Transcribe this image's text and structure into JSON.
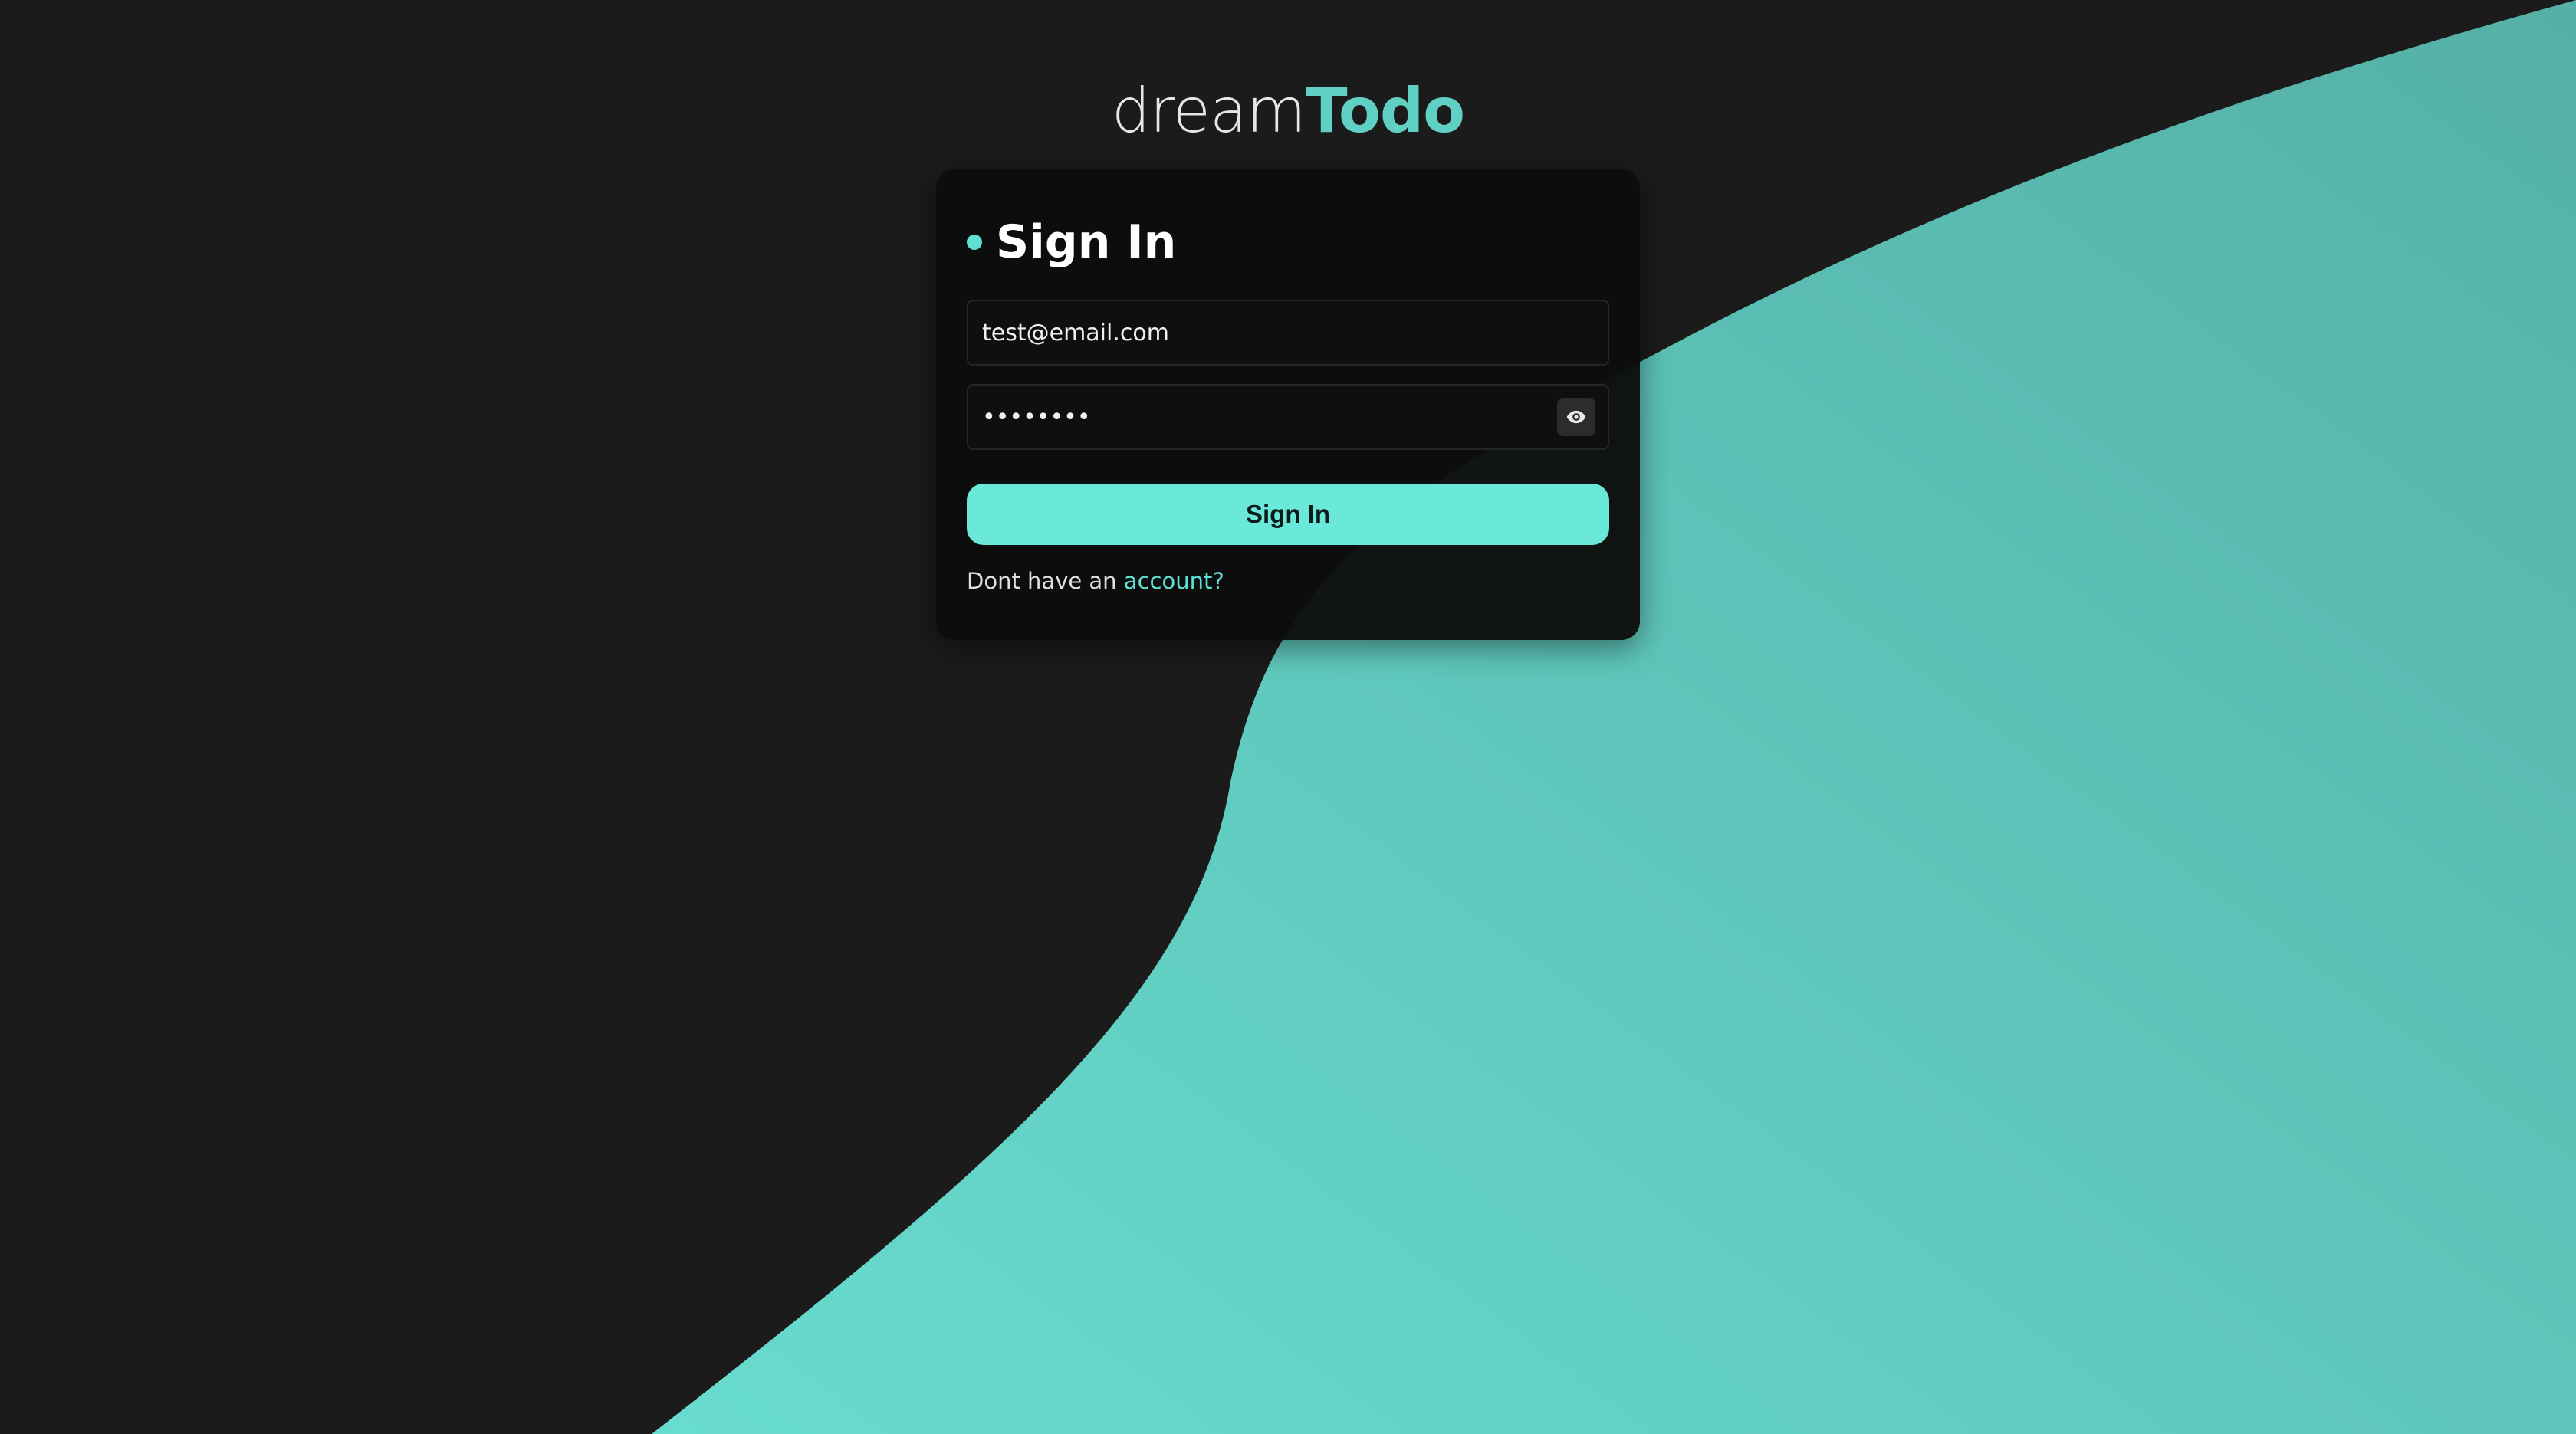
{
  "app": {
    "logo_light": "dream",
    "logo_bold": "Todo"
  },
  "signin": {
    "title": "Sign In",
    "email_value": "test@email.com",
    "password_value": "••••••••",
    "button_label": "Sign In",
    "footer_text": "Dont have an ",
    "footer_link": "account?"
  },
  "icons": {
    "password_toggle": "eye-icon",
    "title_marker": "dot-icon"
  },
  "colors": {
    "accent": "#6ae8da",
    "background": "#1b1b1b",
    "card": "#0d0d0d",
    "wave": "#5cc2b5"
  }
}
